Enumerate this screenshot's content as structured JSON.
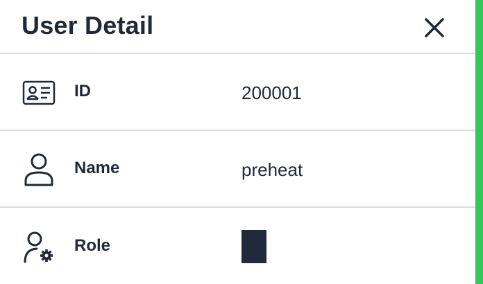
{
  "header": {
    "title": "User Detail",
    "close_icon": "close-icon"
  },
  "fields": [
    {
      "icon": "id-card-icon",
      "label": "ID",
      "value": "200001"
    },
    {
      "icon": "user-icon",
      "label": "Name",
      "value": "preheat"
    },
    {
      "icon": "user-gear-icon",
      "label": "Role",
      "value": ""
    }
  ],
  "colors": {
    "text": "#1f2937",
    "divider": "#dcdcdc",
    "accent": "#34c759",
    "role_swatch": "#1f2a3c"
  }
}
